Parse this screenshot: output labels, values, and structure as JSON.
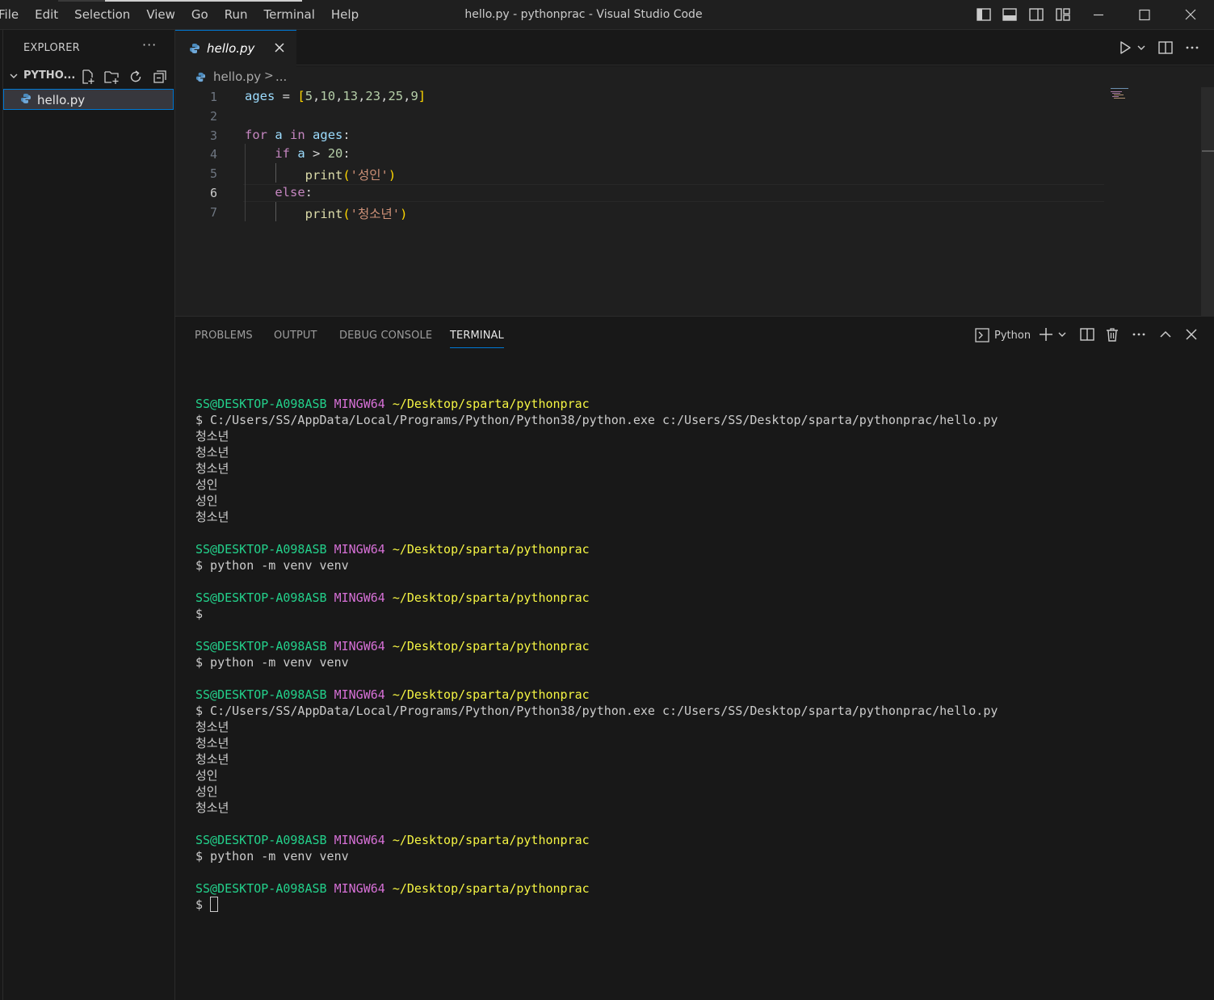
{
  "titlebar": {
    "menu": [
      "File",
      "Edit",
      "Selection",
      "View",
      "Go",
      "Run",
      "Terminal",
      "Help"
    ],
    "window_title": "hello.py - pythonprac - Visual Studio Code"
  },
  "sidebar": {
    "title": "EXPLORER",
    "more": "···",
    "folder": "PYTHO...",
    "file": "hello.py"
  },
  "editor": {
    "tab_label": "hello.py",
    "breadcrumb_file": "hello.py",
    "breadcrumb_sep": ">",
    "breadcrumb_more": "...",
    "line_numbers": [
      "1",
      "2",
      "3",
      "4",
      "5",
      "6",
      "7"
    ],
    "current_line": 6,
    "code_lines": [
      "ages = [5,10,13,23,25,9]",
      "",
      "for a in ages:",
      "    if a > 20:",
      "        print('성인')",
      "    else:",
      "        print('청소년')"
    ]
  },
  "panel": {
    "tabs": [
      "PROBLEMS",
      "OUTPUT",
      "DEBUG CONSOLE",
      "TERMINAL"
    ],
    "active_tab": "TERMINAL",
    "terminal_name": "Python"
  },
  "terminal": {
    "user": "SS@DESKTOP-A098ASB",
    "system": "MINGW64",
    "cwd": "~/Desktop/sparta/pythonprac",
    "prompt": "$",
    "run_command": "C:/Users/SS/AppData/Local/Programs/Python/Python38/python.exe c:/Users/SS/Desktop/sparta/pythonprac/hello.py",
    "venv_command": "python -m venv venv",
    "output": [
      "청소년",
      "청소년",
      "청소년",
      "성인",
      "성인",
      "청소년"
    ],
    "lines": [
      {
        "type": "blank"
      },
      {
        "type": "prompt"
      },
      {
        "type": "cmd",
        "text": "$ C:/Users/SS/AppData/Local/Programs/Python/Python38/python.exe c:/Users/SS/Desktop/sparta/pythonprac/hello.py"
      },
      {
        "type": "out",
        "text": "청소년"
      },
      {
        "type": "out",
        "text": "청소년"
      },
      {
        "type": "out",
        "text": "청소년"
      },
      {
        "type": "out",
        "text": "성인"
      },
      {
        "type": "out",
        "text": "성인"
      },
      {
        "type": "out",
        "text": "청소년"
      },
      {
        "type": "blank"
      },
      {
        "type": "prompt"
      },
      {
        "type": "cmd",
        "text": "$ python -m venv venv"
      },
      {
        "type": "blank"
      },
      {
        "type": "prompt"
      },
      {
        "type": "cmd",
        "text": "$"
      },
      {
        "type": "blank"
      },
      {
        "type": "prompt"
      },
      {
        "type": "cmd",
        "text": "$ python -m venv venv"
      },
      {
        "type": "blank"
      },
      {
        "type": "prompt"
      },
      {
        "type": "cmd",
        "text": "$ C:/Users/SS/AppData/Local/Programs/Python/Python38/python.exe c:/Users/SS/Desktop/sparta/pythonprac/hello.py"
      },
      {
        "type": "out",
        "text": "청소년"
      },
      {
        "type": "out",
        "text": "청소년"
      },
      {
        "type": "out",
        "text": "청소년"
      },
      {
        "type": "out",
        "text": "성인"
      },
      {
        "type": "out",
        "text": "성인"
      },
      {
        "type": "out",
        "text": "청소년"
      },
      {
        "type": "blank"
      },
      {
        "type": "prompt"
      },
      {
        "type": "cmd",
        "text": "$ python -m venv venv"
      },
      {
        "type": "blank"
      },
      {
        "type": "prompt"
      },
      {
        "type": "cursor",
        "text": "$ "
      }
    ]
  },
  "colors": {
    "accent": "#0078d4",
    "terminal_user": "#23d18b",
    "terminal_system": "#d670d6",
    "terminal_path": "#f5f543"
  },
  "icons": {
    "python_file": "python-file-icon",
    "close": "close-icon",
    "run": "run-icon",
    "split": "split-editor-icon"
  }
}
